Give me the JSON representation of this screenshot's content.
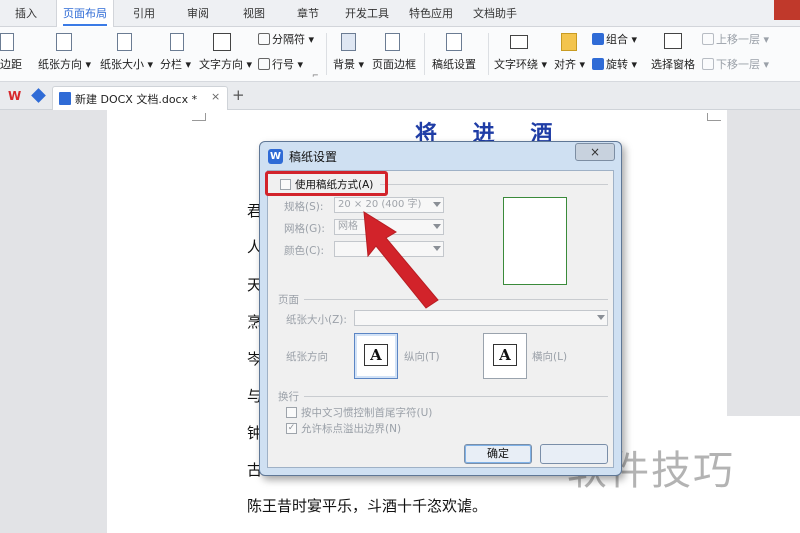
{
  "menu": {
    "items": [
      "插入",
      "页面布局",
      "引用",
      "审阅",
      "视图",
      "章节",
      "开发工具",
      "特色应用",
      "文档助手"
    ],
    "active": "页面布局"
  },
  "ribbon": {
    "margins": "边距",
    "orientation": "纸张方向",
    "size": "纸张大小",
    "columns": "分栏",
    "text_direction": "文字方向",
    "breaks": "分隔符",
    "line_numbers": "行号",
    "background": "背景",
    "page_borders": "页面边框",
    "manuscript": "稿纸设置",
    "wrap": "文字环绕",
    "align": "对齐",
    "group": "组合",
    "rotate": "旋转",
    "selection_pane": "选择窗格",
    "bring_forward": "上移一层",
    "send_backward": "下移一层",
    "corner_launcher": "⌐"
  },
  "tabs": {
    "doc_title": "新建 DOCX 文档.docx *",
    "close": "×",
    "new": "+"
  },
  "document": {
    "title": "将 进 酒",
    "lines": [
      "君",
      "人",
      "天",
      "烹",
      "岑",
      "与",
      "钟",
      "古",
      "陈王昔时宴平乐，斗酒十千恣欢谑。"
    ]
  },
  "dialog": {
    "title": "稿纸设置",
    "close": "×",
    "use_manuscript": "使用稿纸方式(A)",
    "spec_label": "规格(S):",
    "spec_value": "20 × 20 (400 字)",
    "grid_label": "网格(G):",
    "grid_value": "网格",
    "color_label": "颜色(C):",
    "color_value": "",
    "page_group": "页面",
    "paper_size_label": "纸张大小(Z):",
    "orientation_label": "纸张方向",
    "portrait": "纵向(T)",
    "landscape": "横向(L)",
    "wrap_group": "换行",
    "opt_chinese_rule": "按中文习惯控制首尾字符(U)",
    "opt_overflow": "允许标点溢出边界(N)",
    "ok": "确定",
    "cancel": ""
  },
  "watermark": "软件技巧",
  "colors": {
    "accent": "#2f6bd6",
    "highlight_red": "#d2232a",
    "title_blue": "#1f3da6"
  }
}
